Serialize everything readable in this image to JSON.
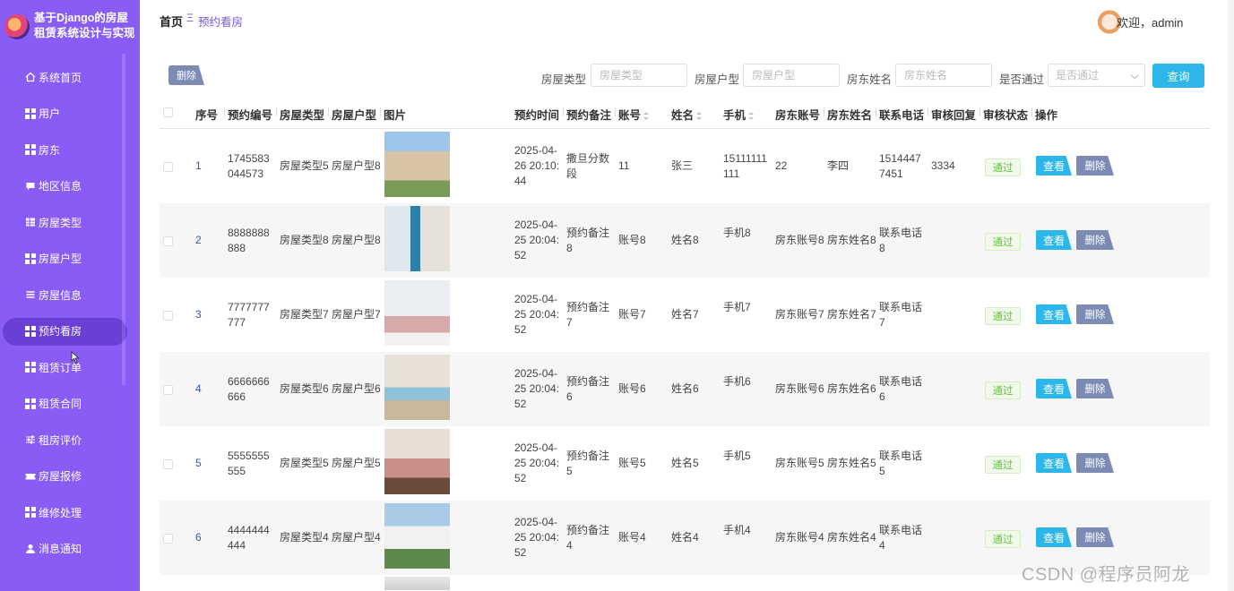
{
  "app": {
    "title": "基于Django的房屋租赁系统设计与实现"
  },
  "sidebar": {
    "items": [
      {
        "label": "系统首页",
        "icon": "home-icon"
      },
      {
        "label": "用户",
        "icon": "grid-icon"
      },
      {
        "label": "房东",
        "icon": "grid-icon"
      },
      {
        "label": "地区信息",
        "icon": "chat-icon"
      },
      {
        "label": "房屋类型",
        "icon": "table-icon"
      },
      {
        "label": "房屋户型",
        "icon": "grid-icon"
      },
      {
        "label": "房屋信息",
        "icon": "list-icon"
      },
      {
        "label": "预约看房",
        "icon": "grid-icon",
        "active": true
      },
      {
        "label": "租赁订单",
        "icon": "grid-icon"
      },
      {
        "label": "租赁合同",
        "icon": "grid-icon"
      },
      {
        "label": "租房评价",
        "icon": "sliders-icon"
      },
      {
        "label": "房屋报修",
        "icon": "ticket-icon"
      },
      {
        "label": "维修处理",
        "icon": "grid-icon"
      },
      {
        "label": "消息通知",
        "icon": "user-icon"
      }
    ]
  },
  "header": {
    "breadcrumb_home": "首页",
    "breadcrumb_sep": "Ξ",
    "breadcrumb_current": "预约看房",
    "welcome": "欢迎，admin"
  },
  "toolbar": {
    "delete_label": "删除",
    "filters": [
      {
        "label": "房屋类型",
        "placeholder": "房屋类型"
      },
      {
        "label": "房屋户型",
        "placeholder": "房屋户型"
      },
      {
        "label": "房东姓名",
        "placeholder": "房东姓名"
      }
    ],
    "approved_label": "是否通过",
    "approved_placeholder": "是否通过",
    "query_label": "查询"
  },
  "table": {
    "headers": {
      "index": "序号",
      "code": "预约编号",
      "type": "房屋类型",
      "layout": "房屋户型",
      "image": "图片",
      "time": "预约时间",
      "note": "预约备注",
      "account": "账号",
      "name": "姓名",
      "phone": "手机",
      "landlord_account": "房东账号",
      "landlord_name": "房东姓名",
      "contact": "联系电话",
      "reply": "审核回复",
      "status": "审核状态",
      "actions": "操作"
    },
    "rows": [
      {
        "index": "1",
        "code": "1745583044573",
        "type": "房屋类型5",
        "layout": "房屋户型8",
        "time": "2025-04-26 20:10:44",
        "note": "撒旦分数段",
        "account": "11",
        "name": "张三",
        "phone": "15111111111",
        "landlord_account": "22",
        "landlord_name": "李四",
        "contact": "15144477451",
        "reply": "3334",
        "status": "通过"
      },
      {
        "index": "2",
        "code": "8888888888",
        "type": "房屋类型8",
        "layout": "房屋户型8",
        "time": "2025-04-25 20:04:52",
        "note": "预约备注8",
        "account": "账号8",
        "name": "姓名8",
        "phone": "手机8",
        "landlord_account": "房东账号8",
        "landlord_name": "房东姓名8",
        "contact": "联系电话8",
        "reply": "",
        "status": "通过"
      },
      {
        "index": "3",
        "code": "7777777777",
        "type": "房屋类型7",
        "layout": "房屋户型7",
        "time": "2025-04-25 20:04:52",
        "note": "预约备注7",
        "account": "账号7",
        "name": "姓名7",
        "phone": "手机7",
        "landlord_account": "房东账号7",
        "landlord_name": "房东姓名7",
        "contact": "联系电话7",
        "reply": "",
        "status": "通过"
      },
      {
        "index": "4",
        "code": "6666666666",
        "type": "房屋类型6",
        "layout": "房屋户型6",
        "time": "2025-04-25 20:04:52",
        "note": "预约备注6",
        "account": "账号6",
        "name": "姓名6",
        "phone": "手机6",
        "landlord_account": "房东账号6",
        "landlord_name": "房东姓名6",
        "contact": "联系电话6",
        "reply": "",
        "status": "通过"
      },
      {
        "index": "5",
        "code": "5555555555",
        "type": "房屋类型5",
        "layout": "房屋户型5",
        "time": "2025-04-25 20:04:52",
        "note": "预约备注5",
        "account": "账号5",
        "name": "姓名5",
        "phone": "手机5",
        "landlord_account": "房东账号5",
        "landlord_name": "房东姓名5",
        "contact": "联系电话5",
        "reply": "",
        "status": "通过"
      },
      {
        "index": "6",
        "code": "4444444444",
        "type": "房屋类型4",
        "layout": "房屋户型4",
        "time": "2025-04-25 20:04:52",
        "note": "预约备注4",
        "account": "账号4",
        "name": "姓名4",
        "phone": "手机4",
        "landlord_account": "房东账号4",
        "landlord_name": "房东姓名4",
        "contact": "联系电话4",
        "reply": "",
        "status": "通过"
      }
    ],
    "view_label": "查看",
    "delete_label": "删除"
  },
  "watermark": "CSDN @程序员阿龙",
  "colors": {
    "sidebar": "#8a5cf6",
    "active": "#6a3fd6",
    "primary": "#2cb6ea",
    "danger_muted": "#7b8bb4",
    "success": "#67c23a"
  }
}
